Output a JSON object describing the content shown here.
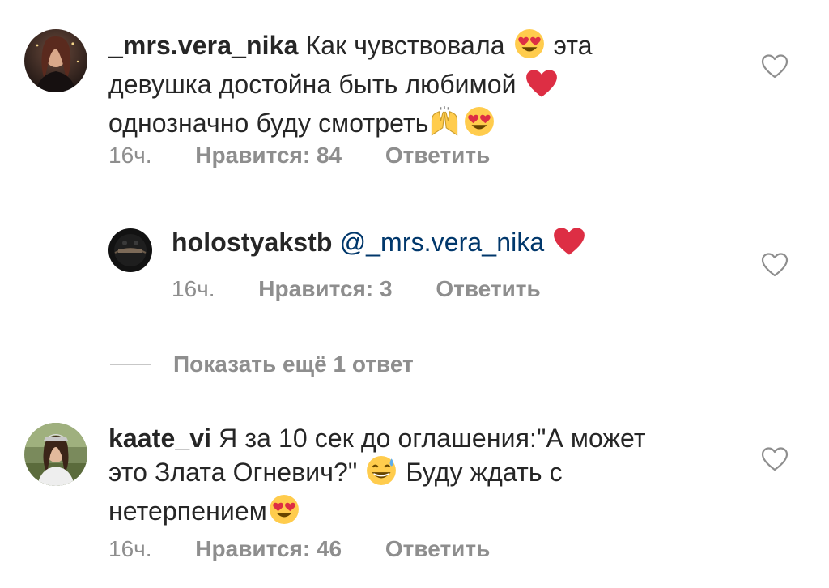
{
  "comments": [
    {
      "username": "_mrs.vera_nika",
      "line1": "Как чувствовала",
      "line1b": "эта",
      "line2": "девушка достойна быть любимой",
      "line3": "однозначно буду смотреть",
      "emoji": [
        "heart-eyes-emoji",
        "red-heart-emoji",
        "raising-hands-emoji",
        "heart-eyes-emoji"
      ],
      "time": "16ч.",
      "likes": "Нравится: 84",
      "reply": "Ответить"
    },
    {
      "username": "holostyakstb",
      "mention": "@_mrs.vera_nika",
      "emoji": [
        "red-heart-emoji"
      ],
      "time": "16ч.",
      "likes": "Нравится: 3",
      "reply": "Ответить"
    },
    {
      "username": "kaate_vi",
      "line1": "Я за 10 сек до оглашения:\"А может",
      "line2a": "это Злата Огневич?\"",
      "line2b": "Буду ждать с",
      "line3": "нетерпением",
      "emoji": [
        "grinning-sweat-emoji",
        "heart-eyes-emoji"
      ],
      "time": "16ч.",
      "likes": "Нравится: 46",
      "reply": "Ответить"
    }
  ],
  "show_more": "Показать ещё 1 ответ",
  "colors": {
    "text": "#262626",
    "secondary": "#8e8e8e",
    "mention": "#00376b",
    "heart_red": "#e0245e",
    "emoji_yellow": "#ffcc4d"
  },
  "icons": {
    "like": "heart-outline-icon"
  }
}
